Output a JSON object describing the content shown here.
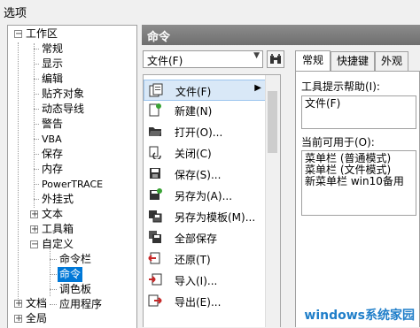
{
  "window": {
    "title": "选项"
  },
  "tree": {
    "items": [
      {
        "label": "工作区",
        "toggle": "−"
      },
      {
        "label": "常规"
      },
      {
        "label": "显示"
      },
      {
        "label": "编辑"
      },
      {
        "label": "贴齐对象"
      },
      {
        "label": "动态导线"
      },
      {
        "label": "警告"
      },
      {
        "label": "VBA"
      },
      {
        "label": "保存"
      },
      {
        "label": "内存"
      },
      {
        "label": "PowerTRACE"
      },
      {
        "label": "外挂式"
      },
      {
        "label": "文本",
        "toggle": "+"
      },
      {
        "label": "工具箱",
        "toggle": "+"
      },
      {
        "label": "自定义",
        "toggle": "−"
      },
      {
        "label": "命令栏"
      },
      {
        "label": "命令",
        "selected": true
      },
      {
        "label": "调色板"
      },
      {
        "label": "应用程序"
      },
      {
        "label": "文档",
        "toggle": "+"
      },
      {
        "label": "全局",
        "toggle": "+"
      }
    ]
  },
  "header": {
    "title": "命令"
  },
  "category_dropdown": {
    "value": "文件(F)",
    "icon": "binoculars-icon"
  },
  "commands": [
    {
      "label": "文件(F)",
      "icon": "file-menu-icon",
      "selected": true,
      "submenu": "▶"
    },
    {
      "label": "新建(N)",
      "icon": "new-doc-icon"
    },
    {
      "label": "打开(O)...",
      "icon": "open-folder-icon"
    },
    {
      "label": "关闭(C)",
      "icon": "close-doc-icon"
    },
    {
      "label": "保存(S)...",
      "icon": "save-icon"
    },
    {
      "label": "另存为(A)...",
      "icon": "save-as-icon"
    },
    {
      "label": "另存为模板(M)...",
      "icon": "save-template-icon"
    },
    {
      "label": "全部保存",
      "icon": "save-all-icon"
    },
    {
      "label": "还原(T)",
      "icon": "revert-icon"
    },
    {
      "label": "导入(I)...",
      "icon": "import-icon"
    },
    {
      "label": "导出(E)...",
      "icon": "export-icon"
    }
  ],
  "tabs": [
    {
      "label": "常规",
      "active": true
    },
    {
      "label": "快捷键"
    },
    {
      "label": "外观"
    }
  ],
  "general": {
    "tooltip_label": "工具提示帮助(I):",
    "tooltip_value": "文件(F)",
    "available_label": "当前可用于(O):",
    "available_lines": [
      "菜单栏 (普通模式)",
      "菜单栏 (文件模式)",
      "新菜单栏 win10备用"
    ]
  },
  "watermark": {
    "text": "windows系统家园"
  },
  "colors": {
    "selection": "#0078d7",
    "header": "#7a7a7a",
    "list_selection": "#d9e8f7"
  }
}
